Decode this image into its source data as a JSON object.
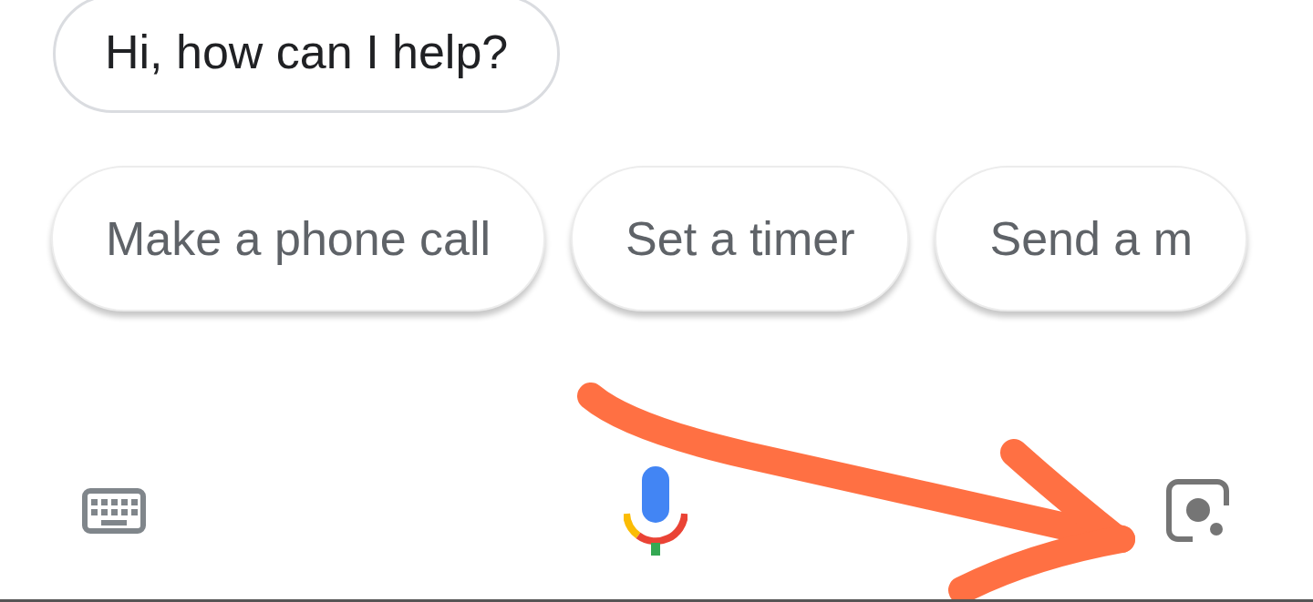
{
  "greeting": {
    "text": "Hi, how can I help?"
  },
  "suggestions": [
    {
      "label": "Make a phone call"
    },
    {
      "label": "Set a timer"
    },
    {
      "label": "Send a m"
    }
  ],
  "annotation": {
    "kind": "arrow",
    "color": "#ff7043"
  }
}
